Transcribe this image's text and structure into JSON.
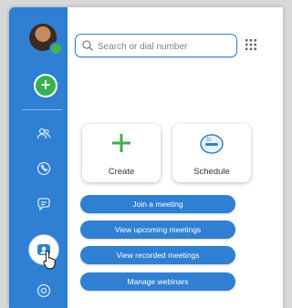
{
  "search": {
    "placeholder": "Search or dial number"
  },
  "tiles": {
    "create_label": "Create",
    "schedule_label": "Schedule"
  },
  "actions": [
    {
      "label": "Join a meeting"
    },
    {
      "label": "View upcoming meetings"
    },
    {
      "label": "View recorded meetings"
    },
    {
      "label": "Manage webinars"
    }
  ],
  "colors": {
    "brand_blue": "#2f7fd3",
    "accent_green": "#37b24d",
    "presence_green": "#3fb24f"
  },
  "icons": {
    "sidebar": [
      "contacts-icon",
      "phone-icon",
      "chat-icon",
      "meetings-icon",
      "webinar-icon"
    ],
    "toolbar": [
      "search-icon",
      "dialpad-icon"
    ]
  }
}
